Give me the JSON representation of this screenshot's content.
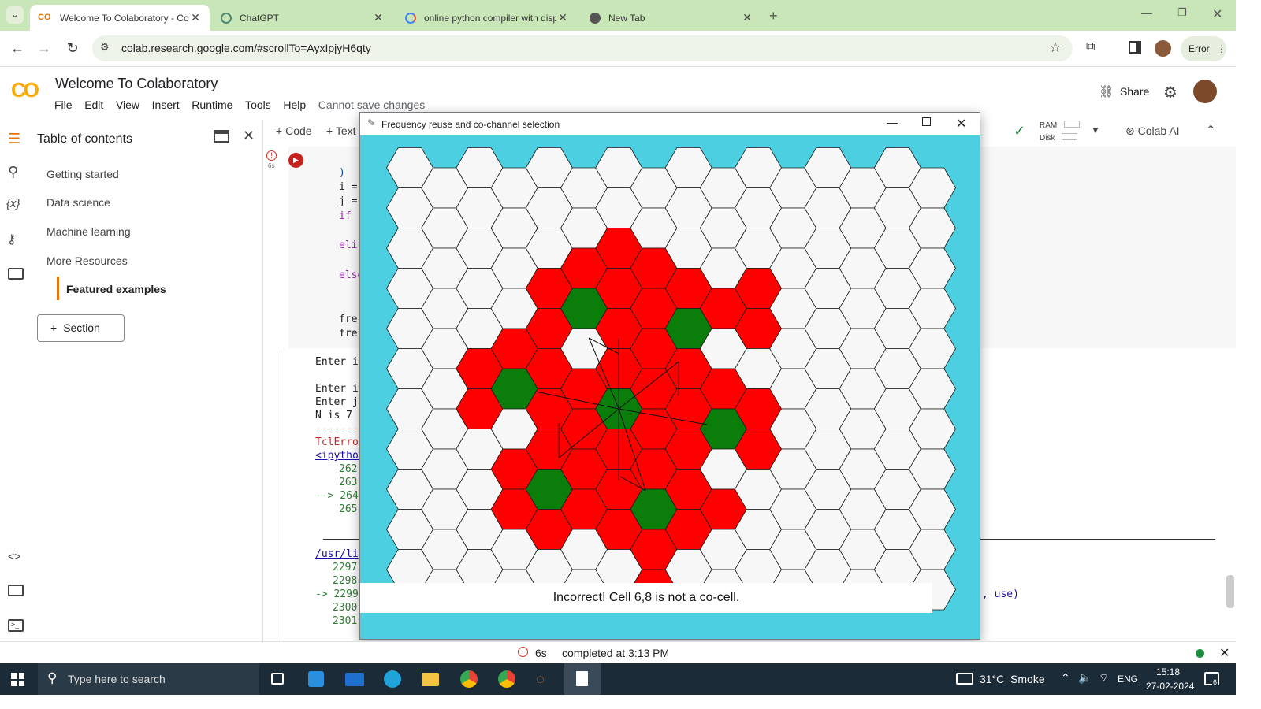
{
  "browser": {
    "tabs": [
      {
        "title": "Welcome To Colaboratory - Colab",
        "active": true,
        "icon": "colab-icon"
      },
      {
        "title": "ChatGPT",
        "active": false,
        "icon": "chatgpt-icon"
      },
      {
        "title": "online python compiler with display",
        "active": false,
        "icon": "google-icon"
      },
      {
        "title": "New Tab",
        "active": false,
        "icon": "chrome-icon"
      }
    ],
    "url": "colab.research.google.com/#scrollTo=AyxIpjyH6qty",
    "profile_status": "Error"
  },
  "colab": {
    "title": "Welcome To Colaboratory",
    "menu": [
      "File",
      "Edit",
      "View",
      "Insert",
      "Runtime",
      "Tools",
      "Help"
    ],
    "save_status": "Cannot save changes",
    "share_label": "Share",
    "toolbar": {
      "code_label": "Code",
      "text_label": "Text",
      "ram_label": "RAM",
      "disk_label": "Disk",
      "colab_ai_label": "Colab AI"
    },
    "toc": {
      "title": "Table of contents",
      "items": [
        "Getting started",
        "Data science",
        "Machine learning",
        "More Resources"
      ],
      "subitem": "Featured examples",
      "section_button": "Section"
    },
    "cell": {
      "exec_time": "6s",
      "code_lines": [
        ")",
        "i =",
        "j =",
        "if",
        "eli",
        "else",
        "fre",
        "fre"
      ],
      "output_lines": [
        "Enter i",
        "",
        "Enter i",
        "Enter j",
        "N is 7",
        "-------",
        "TclError",
        "<ipython",
        "262",
        "263",
        "--> 264",
        "265"
      ],
      "trace_lines": [
        "/usr/li",
        "2297",
        "2298",
        "-> 2299",
        "2300",
        "2301"
      ],
      "trace_tail": ", use)"
    },
    "status": {
      "time": "6s",
      "text": "completed at 3:13 PM"
    }
  },
  "tk_window": {
    "title": "Frequency reuse and co-channel selection",
    "message": "Incorrect! Cell 6,8 is not a co-cell.",
    "colors": {
      "background": "#4ccfe0",
      "cell": "#f7f7f7",
      "cluster": "#ff0000",
      "cochannel": "#0a7d0a",
      "outline": "#1a1a1a"
    },
    "grid": {
      "columns": 16,
      "rows": 11
    }
  },
  "taskbar": {
    "search_placeholder": "Type here to search",
    "weather": "31°C  Smoke",
    "lang": "ENG",
    "time": "15:18",
    "date": "27-02-2024",
    "notif": "6"
  }
}
